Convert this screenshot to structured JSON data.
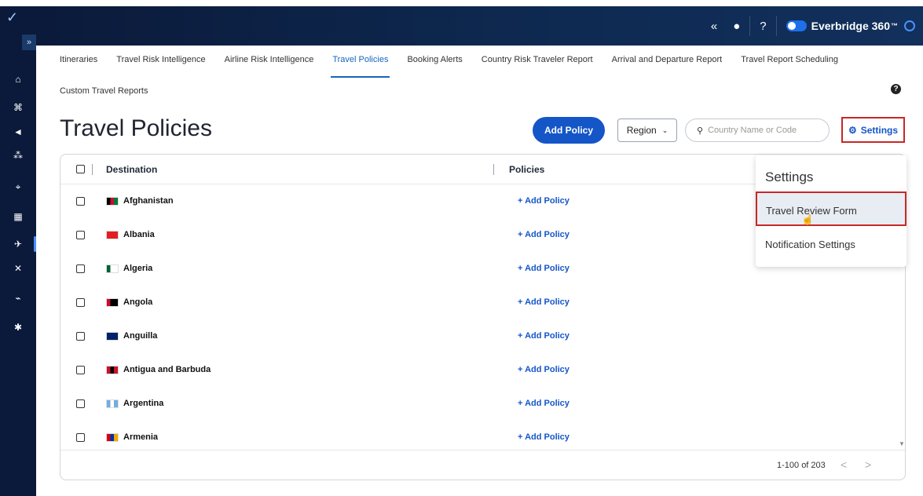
{
  "header": {
    "collapse_icon": "double-chevron-left-icon",
    "user_icon": "user-icon",
    "help_icon": "question-circle-icon",
    "brand": "Everbridge 360",
    "trademark": "™"
  },
  "sidebar": {
    "expand_label": "»",
    "items": [
      {
        "icon": "home-icon",
        "glyph": "⌂"
      },
      {
        "icon": "building-icon",
        "glyph": "⌘"
      },
      {
        "icon": "megaphone-icon",
        "glyph": "◄"
      },
      {
        "icon": "people-icon",
        "glyph": "⁂"
      },
      {
        "icon": "location-pin-icon",
        "glyph": "⌖"
      },
      {
        "icon": "calendar-icon",
        "glyph": "▦"
      },
      {
        "icon": "airplane-icon",
        "glyph": "✈"
      },
      {
        "icon": "flight-off-icon",
        "glyph": "✕"
      },
      {
        "icon": "chart-icon",
        "glyph": "⌁"
      },
      {
        "icon": "gear-icon",
        "glyph": "✱"
      }
    ]
  },
  "tabs": [
    "Itineraries",
    "Travel Risk Intelligence",
    "Airline Risk Intelligence",
    "Travel Policies",
    "Booking Alerts",
    "Country Risk Traveler Report",
    "Arrival and Departure Report",
    "Travel Report Scheduling"
  ],
  "tab_row2": "Custom Travel Reports",
  "active_tab": "Travel Policies",
  "page": {
    "title": "Travel Policies",
    "add_policy": "Add Policy",
    "region": "Region",
    "search_placeholder": "Country Name or Code",
    "settings": "Settings"
  },
  "table": {
    "col_destination": "Destination",
    "col_policies": "Policies",
    "rows": [
      {
        "country": "Afghanistan",
        "action": "+ Add Policy",
        "flag": [
          "#000000",
          "#c8102e",
          "#007a36"
        ]
      },
      {
        "country": "Albania",
        "action": "+ Add Policy",
        "flag": [
          "#e41e20",
          "#e41e20",
          "#e41e20"
        ]
      },
      {
        "country": "Algeria",
        "action": "+ Add Policy",
        "flag": [
          "#006233",
          "#ffffff",
          "#ffffff"
        ]
      },
      {
        "country": "Angola",
        "action": "+ Add Policy",
        "flag": [
          "#cc092f",
          "#000000",
          "#000000"
        ]
      },
      {
        "country": "Anguilla",
        "action": "+ Add Policy",
        "flag": [
          "#012169",
          "#012169",
          "#012169"
        ]
      },
      {
        "country": "Antigua and Barbuda",
        "action": "+ Add Policy",
        "flag": [
          "#ce1126",
          "#000000",
          "#ce1126"
        ]
      },
      {
        "country": "Argentina",
        "action": "+ Add Policy",
        "flag": [
          "#74acdf",
          "#ffffff",
          "#74acdf"
        ]
      },
      {
        "country": "Armenia",
        "action": "+ Add Policy",
        "flag": [
          "#d90012",
          "#0033a0",
          "#f2a800"
        ]
      }
    ],
    "pagination": "1-100 of 203",
    "prev": "<",
    "next": ">"
  },
  "settings_menu": {
    "title": "Settings",
    "items": [
      "Travel Review Form",
      "Notification Settings"
    ]
  },
  "colors": {
    "accent": "#1456c8",
    "highlight_border": "#c62828",
    "nav_bg": "#0b1a3a"
  }
}
